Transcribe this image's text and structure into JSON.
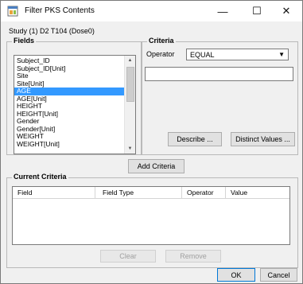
{
  "window": {
    "title": "Filter PKS Contents",
    "minimize_glyph": "—",
    "maximize_glyph": "☐",
    "close_glyph": "✕",
    "icon": "app-window-icon"
  },
  "study": "Study (1) D2 T104 (Dose0)",
  "fields": {
    "title": "Fields",
    "items": [
      "Subject_ID",
      "Subject_ID[Unit]",
      "Site",
      "Site[Unit]",
      "AGE",
      "AGE[Unit]",
      "HEIGHT",
      "HEIGHT[Unit]",
      "Gender",
      "Gender[Unit]",
      "WEIGHT",
      "WEIGHT[Unit]"
    ],
    "selected": "AGE"
  },
  "criteria": {
    "title": "Criteria",
    "operator_label": "Operator",
    "operator_value": "EQUAL",
    "value_text": "",
    "describe_label": "Describe ...",
    "distinct_label": "Distinct Values ..."
  },
  "add_criteria_label": "Add Criteria",
  "current_criteria": {
    "title": "Current Criteria",
    "columns": [
      "Field",
      "Field Type",
      "Operator",
      "Value"
    ],
    "rows": []
  },
  "clear_label": "Clear",
  "remove_label": "Remove",
  "ok_label": "OK",
  "cancel_label": "Cancel",
  "colors": {
    "selection": "#3399ff",
    "window_bg": "#f0f0f0",
    "default_button_border": "#0078d7"
  }
}
